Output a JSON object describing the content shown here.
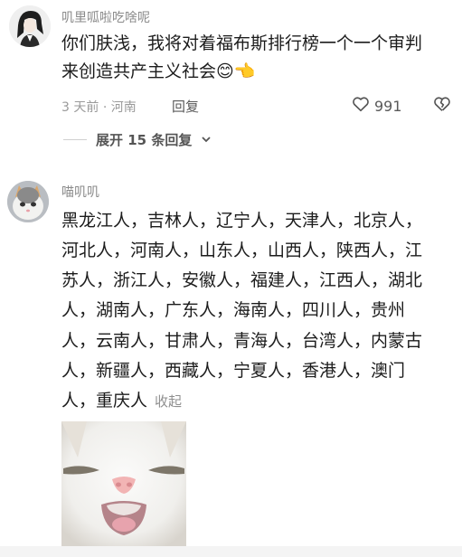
{
  "comment1": {
    "username": "叽里呱啦吃啥呢",
    "text_line1": "你们肤浅，我将对着福布斯排行榜一个一个审判",
    "text_line2": "来创造共产主义社会😊👈",
    "time": "3 天前",
    "dot": "·",
    "location": "河南",
    "reply_label": "回复",
    "likes": "991"
  },
  "expand_replies": {
    "label": "展开 15 条回复"
  },
  "comment2": {
    "username": "喵叽叽",
    "lines": [
      "黑龙江人，吉林人，辽宁人，天津人，北京人，",
      "河北人，河南人，山东人，山西人，陕西人，江",
      "苏人，浙江人，安徽人，福建人，江西人，湖北",
      "人，湖南人，广东人，海南人，四川人，贵州",
      "人，云南人，甘肃人，青海人，台湾人，内蒙古",
      "人，新疆人，西藏人，宁夏人，香港人，澳门",
      "人，重庆人"
    ],
    "collapse_label": "收起"
  },
  "icons": {
    "like": "heart-icon",
    "dislike": "broken-heart-icon",
    "chevron": "chevron-down-icon"
  }
}
